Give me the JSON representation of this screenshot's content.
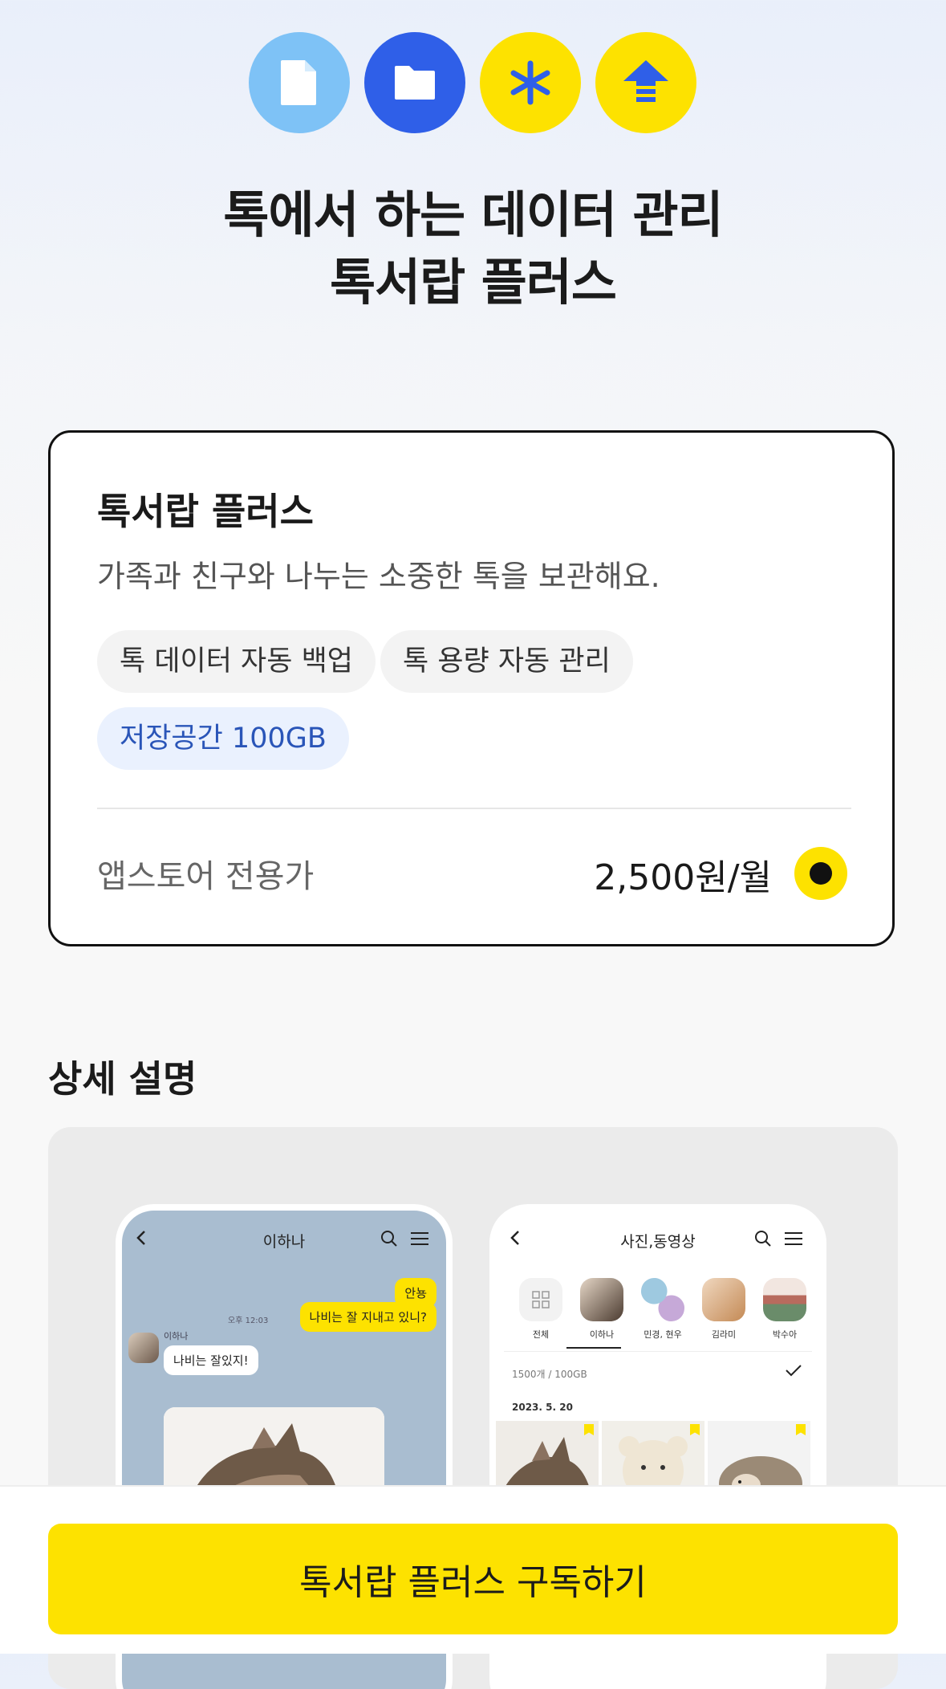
{
  "hero": {
    "title_line1": "톡에서 하는 데이터 관리",
    "title_line2": "톡서랍 플러스",
    "icons": [
      "document-icon",
      "folder-icon",
      "asterisk-icon",
      "upload-arrow-icon"
    ]
  },
  "plan": {
    "title": "톡서랍 플러스",
    "description": "가족과 친구와 나누는 소중한 톡을 보관해요.",
    "tags": [
      "톡 데이터 자동 백업",
      "톡 용량 자동 관리",
      "저장공간 100GB"
    ],
    "store_label": "앱스토어 전용가",
    "price": "2,500원/월",
    "selected": true
  },
  "details": {
    "section_title": "상세 설명",
    "chat_screen": {
      "title": "이하나",
      "messages": [
        {
          "text": "안뇽",
          "side": "me"
        },
        {
          "text": "나비는 잘 지내고 있니?",
          "side": "me",
          "time": "오후 12:03"
        },
        {
          "sender": "이하나",
          "text": "나비는 잘있지!",
          "side": "other"
        }
      ]
    },
    "photo_screen": {
      "title": "사진,동영상",
      "friends": [
        "전체",
        "이하나",
        "민경, 현우",
        "김라미",
        "박수아"
      ],
      "storage": "1500개 / 100GB",
      "date": "2023. 5. 20"
    }
  },
  "cta": {
    "label": "톡서랍 플러스 구독하기"
  },
  "colors": {
    "kakao_yellow": "#fde200",
    "blue": "#2f5fe8",
    "light_blue": "#7ec2f6"
  }
}
